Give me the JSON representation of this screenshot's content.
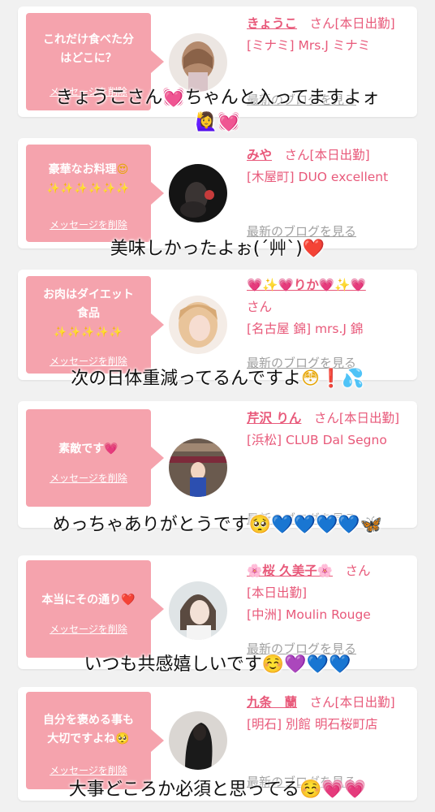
{
  "cards": [
    {
      "message": "これだけ食べた分\nはどこに？",
      "delete_label": "メッセージを削除",
      "name": "きょうこ",
      "suffix": "　さん[本日出勤]",
      "shop": "[ミナミ] Mrs.J ミナミ",
      "blog_label": "最新のブログを見る"
    },
    {
      "message": "豪華なお料理",
      "sparkles": "✨✨✨✨✨✨",
      "delete_label": "メッセージを削除",
      "name": "みや",
      "suffix": "　さん[本日出勤]",
      "shop": "[木屋町] DUO excellent",
      "blog_label": "最新のブログを見る"
    },
    {
      "message": "お肉はダイエット\n食品",
      "sparkles": "✨✨✨✨✨",
      "delete_label": "メッセージを削除",
      "name": "💗✨💗りか💗✨💗",
      "suffix": "さん",
      "shop": "[名古屋 錦] mrs.J 錦",
      "blog_label": "最新のブログを見る"
    },
    {
      "message": "素敵です",
      "delete_label": "メッセージを削除",
      "name": "芹沢 りん",
      "suffix": "　さん[本日出勤]",
      "shop": "[浜松] CLUB Dal Segno",
      "blog_label": "最新のブログを見る"
    },
    {
      "message": "本当にその通り",
      "delete_label": "メッセージを削除",
      "name": "🌸桜 久美子🌸",
      "suffix": "　さん",
      "status": "[本日出勤]",
      "shop": "[中洲] Moulin Rouge",
      "blog_label": "最新のブログを見る"
    },
    {
      "message": "自分を褒める事も\n大切ですよね",
      "delete_label": "メッセージを削除",
      "name": "九条　蘭",
      "suffix": "　さん[本日出勤]",
      "shop": "[明石] 別館 明石桜町店",
      "blog_label": "最新のブログを見る"
    }
  ],
  "overlays": [
    {
      "text": "きょうこさん",
      "text2": "ちゃんと入ってますよォ"
    },
    {
      "text": "美味しかったよぉ(´艸`)"
    },
    {
      "text": "次の日体重減ってるんですよ"
    },
    {
      "text": "めっちゃありがとうです"
    },
    {
      "text": "いつも共感嬉しいです"
    },
    {
      "text": "大事どころか必須と思ってる"
    }
  ],
  "colors": {
    "bubble": "#f5a3ad",
    "accent": "#e8597a",
    "muted": "#a0a0a0",
    "background": "#f1f1f1"
  }
}
